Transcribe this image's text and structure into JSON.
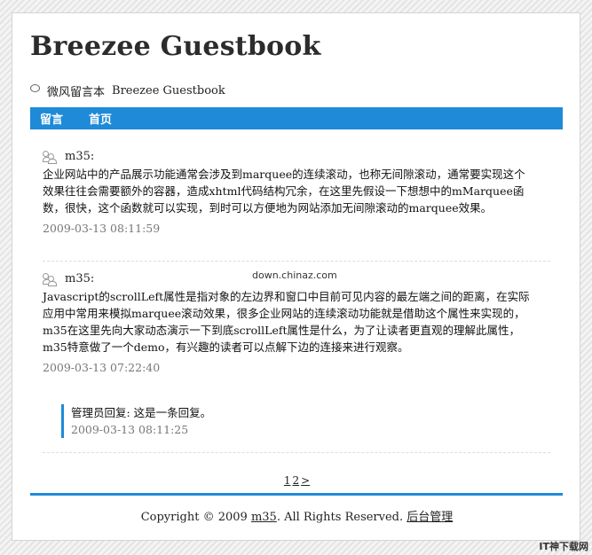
{
  "site": {
    "title": "Breezee Guestbook",
    "tagline_name": "微风留言本",
    "tagline_en": "Breezee Guestbook"
  },
  "nav": {
    "items": [
      {
        "label": "留言"
      },
      {
        "label": "首页"
      }
    ]
  },
  "entries": [
    {
      "author": "m35:",
      "body": "企业网站中的产品展示功能通常会涉及到marquee的连续滚动，也称无间隙滚动，通常要实现这个效果往往会需要额外的容器，造成xhtml代码结构冗余，在这里先假设一下想想中的mMarquee函数，很快，这个函数就可以实现，到时可以方便地为网站添加无间隙滚动的marquee效果。",
      "date": "2009-03-13 08:11:59"
    },
    {
      "author": "m35:",
      "body": "Javascript的scrollLeft属性是指对象的左边界和窗口中目前可见内容的最左端之间的距离，在实际应用中常用来模拟marquee滚动效果，很多企业网站的连续滚动功能就是借助这个属性来实现的，m35在这里先向大家动态演示一下到底scrollLeft属性是什么，为了让读者更直观的理解此属性，m35特意做了一个demo，有兴趣的读者可以点解下边的连接来进行观察。",
      "date": "2009-03-13 07:22:40",
      "reply": {
        "text": "管理员回复: 这是一条回复。",
        "date": "2009-03-13 08:11:25"
      }
    }
  ],
  "pagination": {
    "current": "1",
    "next": "2",
    "arrow": ">"
  },
  "footer": {
    "prefix": "Copyright © 2009",
    "owner_link": "m35",
    "suffix": ". All Rights Reserved.",
    "admin_link": "后台管理"
  },
  "watermark": "down.chinaz.com",
  "corner_logo": "IT神下载网"
}
